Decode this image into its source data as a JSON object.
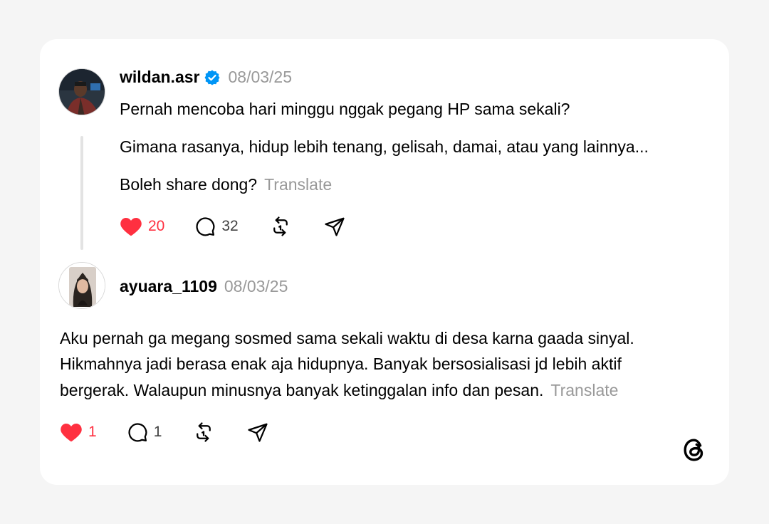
{
  "post": {
    "username": "wildan.asr",
    "date": "08/03/25",
    "line1": "Pernah mencoba hari minggu nggak pegang HP sama sekali?",
    "line2": "Gimana rasanya, hidup lebih tenang, gelisah, damai, atau yang lainnya...",
    "line3": "Boleh share dong?",
    "translate_label": "Translate",
    "likes": "20",
    "replies": "32",
    "verified_icon": "verified-badge-icon"
  },
  "reply": {
    "username": "ayuara_1109",
    "date": "08/03/25",
    "line1": "Aku pernah ga megang sosmed sama sekali waktu di desa karna gaada sinyal.",
    "line2": "Hikmahnya jadi berasa enak aja hidupnya. Banyak bersosialisasi jd lebih aktif",
    "line3": "bergerak. Walaupun minusnya banyak ketinggalan info dan pesan.",
    "translate_label": "Translate",
    "likes": "1",
    "replies": "1"
  },
  "colors": {
    "like_red": "#ff3040",
    "verified_blue": "#0095f6",
    "muted_text": "#999999",
    "card_bg": "#ffffff",
    "page_bg": "#f5f5f5"
  }
}
